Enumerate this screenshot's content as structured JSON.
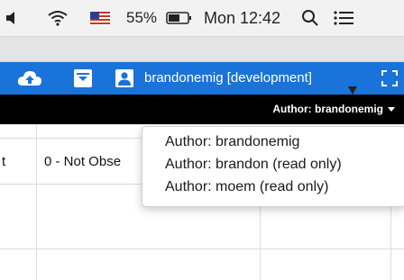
{
  "menubar": {
    "battery_percent": "55%",
    "clock": "Mon 12:42"
  },
  "appbar": {
    "user_label": "brandonemig [development]"
  },
  "authorbar": {
    "current": "Author: brandonemig"
  },
  "table": {
    "row1_col1": "t",
    "row1_col2": "0 - Not Obse"
  },
  "author_menu": {
    "items": [
      "Author: brandonemig",
      "Author: brandon (read only)",
      "Author: moem (read only)"
    ]
  },
  "colors": {
    "appbar_blue": "#1a73d8",
    "authorbar_black": "#000000"
  }
}
